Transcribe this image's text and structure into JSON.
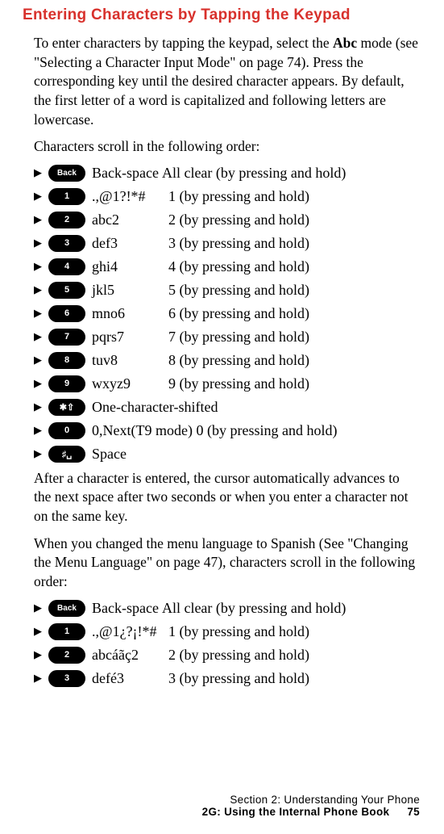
{
  "heading": "Entering Characters by Tapping the Keypad",
  "intro_pre": "To enter characters by tapping the keypad, select the ",
  "intro_bold": "Abc",
  "intro_post": " mode (see \"Selecting a Character Input Mode\" on page 74). Press the corresponding key until the desired character appears. By default, the first letter of a word is capitalized and following letters are lowercase.",
  "para_scroll": "Characters scroll in the following order:",
  "keys": {
    "back": "Back",
    "k1": "1",
    "k2": "2",
    "k3": "3",
    "k4": "4",
    "k5": "5",
    "k6": "6",
    "k7": "7",
    "k8": "8",
    "k9": "9",
    "star": "✱⇧",
    "k0": "0",
    "pound": "♯␣"
  },
  "rows": {
    "back_c1": "Back-space",
    "back_c2": "All clear (by pressing and hold)",
    "r1_c1": ".,@1?!*#",
    "r1_c2": "1 (by pressing and hold)",
    "r2_c1": "abc2",
    "r2_c2": "2 (by pressing and hold)",
    "r3_c1": "def3",
    "r3_c2": "3 (by pressing and hold)",
    "r4_c1": "ghi4",
    "r4_c2": "4 (by pressing and hold)",
    "r5_c1": "jkl5",
    "r5_c2": "5 (by pressing and hold)",
    "r6_c1": "mno6",
    "r6_c2": "6 (by pressing and hold)",
    "r7_c1": "pqrs7",
    "r7_c2": "7 (by pressing and hold)",
    "r8_c1": "tuv8",
    "r8_c2": "8 (by pressing and hold)",
    "r9_c1": "wxyz9",
    "r9_c2": "9 (by pressing and hold)",
    "star_c1": "One-character-shifted",
    "r0_c1": "0,Next(T9 mode) 0 (by pressing and hold)",
    "pound_c1": "Space"
  },
  "para_after": "After a character is entered, the cursor automatically advances to the next space after two seconds or when you enter a character not on the same key.",
  "para_spanish": "When you changed the menu language to Spanish (See \"Changing the Menu Language\" on page 47), characters scroll in the following order:",
  "rows2": {
    "back_c1": "Back-space",
    "back_c2": "All clear (by pressing and hold)",
    "r1_c1": ".,@1¿?¡!*#",
    "r1_c2": "1 (by pressing and hold)",
    "r2_c1": "abcáãç2",
    "r2_c2": "2 (by pressing and hold)",
    "r3_c1": "defé3",
    "r3_c2": "3 (by pressing and hold)"
  },
  "footer": {
    "line1": "Section 2: Understanding Your Phone",
    "line2": "2G: Using the Internal Phone Book",
    "pagenum": "75"
  }
}
